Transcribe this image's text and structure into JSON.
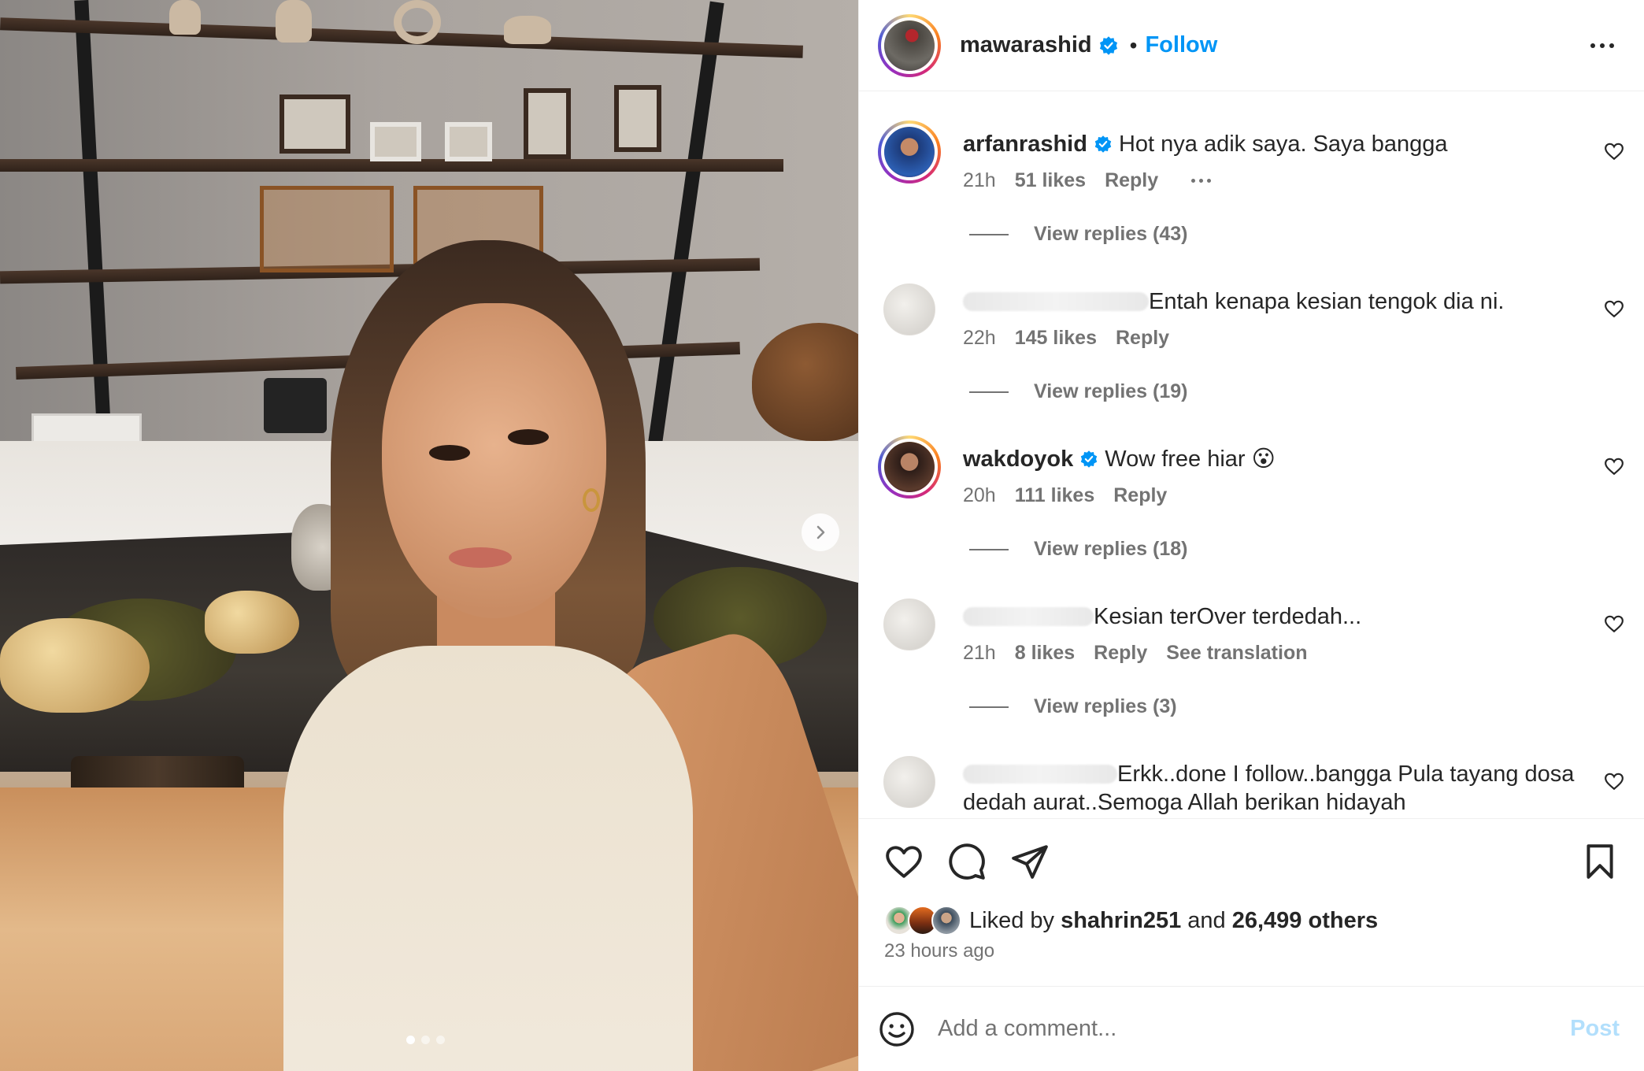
{
  "post": {
    "author": "mawarashid",
    "separator": "•",
    "follow_label": "Follow"
  },
  "comments": [
    {
      "username": "arfanrashid",
      "verified": true,
      "text": "Hot nya adik saya. Saya bangga",
      "time": "21h",
      "likes": "51 likes",
      "reply_label": "Reply",
      "view_replies": "View replies (43)"
    },
    {
      "username_obscured": true,
      "text": "Entah kenapa kesian tengok dia ni.",
      "time": "22h",
      "likes": "145 likes",
      "reply_label": "Reply",
      "view_replies": "View replies (19)"
    },
    {
      "username": "wakdoyok",
      "verified": true,
      "text": "Wow free hiar 😮",
      "time": "20h",
      "likes": "111 likes",
      "reply_label": "Reply",
      "view_replies": "View replies (18)"
    },
    {
      "username_obscured": true,
      "text": "Kesian terOver terdedah...",
      "time": "21h",
      "likes": "8 likes",
      "reply_label": "Reply",
      "translation_label": "See translation",
      "view_replies": "View replies (3)"
    },
    {
      "username_obscured": true,
      "text": "Erkk..done I follow..bangga Pula tayang dosa dedah aurat..Semoga Allah berikan hidayah"
    }
  ],
  "likes": {
    "prefix": "Liked by",
    "first_liker": "shahrin251",
    "conjunction": "and",
    "others": "26,499 others"
  },
  "timestamp": "23 hours ago",
  "add_comment": {
    "placeholder": "Add a comment...",
    "post_label": "Post"
  },
  "icons": {
    "verified": "verified-badge-icon",
    "comment_like": "heart-outline-icon",
    "like": "heart-outline-icon",
    "comment": "speech-bubble-icon",
    "share": "paper-plane-icon",
    "save": "bookmark-icon",
    "emoji": "smiley-icon",
    "more": "more-horizontal-icon",
    "carousel_next": "chevron-right-icon"
  },
  "colors": {
    "link_blue": "#0095f6",
    "post_disabled": "#b2dffc",
    "secondary_text": "#737373",
    "primary_text": "#262626",
    "verified_blue": "#0095f6"
  },
  "carousel": {
    "slides": 3,
    "active": 1
  }
}
